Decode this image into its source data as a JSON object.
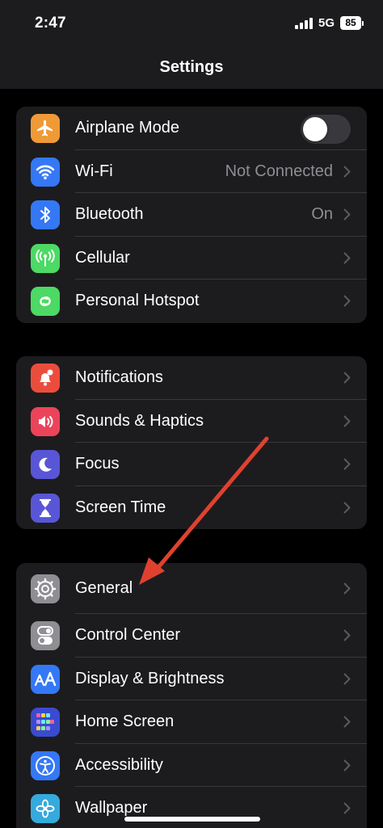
{
  "status_bar": {
    "time": "2:47",
    "network": "5G",
    "battery": "85"
  },
  "header": {
    "title": "Settings"
  },
  "groups": [
    {
      "items": [
        {
          "label": "Airplane Mode",
          "icon": "airplane-icon",
          "icon_color": "#f09a37",
          "toggle": false
        },
        {
          "label": "Wi-Fi",
          "icon": "wifi-icon",
          "icon_color": "#3478f6",
          "value": "Not Connected"
        },
        {
          "label": "Bluetooth",
          "icon": "bluetooth-icon",
          "icon_color": "#3478f6",
          "value": "On"
        },
        {
          "label": "Cellular",
          "icon": "cellular-icon",
          "icon_color": "#4cd964"
        },
        {
          "label": "Personal Hotspot",
          "icon": "hotspot-icon",
          "icon_color": "#4cd964"
        }
      ]
    },
    {
      "items": [
        {
          "label": "Notifications",
          "icon": "bell-icon",
          "icon_color": "#eb4d3d"
        },
        {
          "label": "Sounds & Haptics",
          "icon": "speaker-icon",
          "icon_color": "#eb445a"
        },
        {
          "label": "Focus",
          "icon": "moon-icon",
          "icon_color": "#5856d6"
        },
        {
          "label": "Screen Time",
          "icon": "hourglass-icon",
          "icon_color": "#5856d6"
        }
      ]
    },
    {
      "items": [
        {
          "label": "General",
          "icon": "gear-icon",
          "icon_color": "#8e8e93"
        },
        {
          "label": "Control Center",
          "icon": "switches-icon",
          "icon_color": "#8e8e93"
        },
        {
          "label": "Display & Brightness",
          "icon": "text-size-icon",
          "icon_color": "#3478f6"
        },
        {
          "label": "Home Screen",
          "icon": "app-grid-icon",
          "icon_color": "#3a4bd0"
        },
        {
          "label": "Accessibility",
          "icon": "accessibility-icon",
          "icon_color": "#3478f6"
        },
        {
          "label": "Wallpaper",
          "icon": "flower-icon",
          "icon_color": "#35aadc"
        }
      ]
    }
  ],
  "annotation": {
    "color": "#e0412f"
  }
}
